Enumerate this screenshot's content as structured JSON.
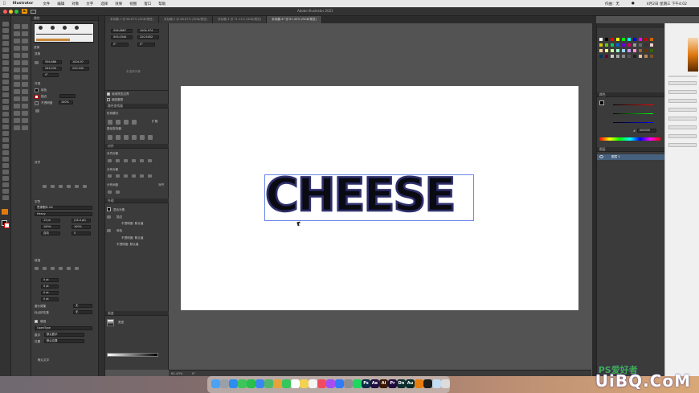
{
  "menubar": {
    "app": "Illustrator",
    "items": [
      "文件",
      "编辑",
      "对象",
      "文字",
      "选择",
      "效果",
      "视图",
      "窗口",
      "帮助"
    ],
    "right_user": "作曲：无",
    "right_clock": "4月2日 星期三 下午4:02"
  },
  "app_title": "Adobe Illustrator 2021",
  "doc_tabs": [
    "未标题-1 @ 66.67% (RGB/预览)",
    "未标题-2 @ 66.67% (RGB/预览)",
    "未标题-3 @ 71.11% (RGB/预览)",
    "未标题-4* @ 61.43% (RGB/预览)"
  ],
  "transform_top": {
    "x": "936.8867",
    "y": "543.0344",
    "w": "1004.974",
    "h": "220.5452",
    "angle": "0°",
    "shear": "0°"
  },
  "properties": {
    "title": "属性",
    "section_transform": "变换",
    "x": "936.886",
    "y": "543.034",
    "w": "1004.97",
    "h": "220.545",
    "angle": "0°",
    "section_appearance": "外观",
    "fill_label": "填色",
    "stroke_label": "描边",
    "opacity_label": "不透明度",
    "opacity_value": "100%",
    "section_align": "对齐",
    "section_character": "字符",
    "font_name": "思源黑体 CN",
    "font_style": "Heavy",
    "font_size": "13 pt",
    "leading": "(14.4 pt)",
    "tracking_a": "100%",
    "tracking_b": "100%",
    "kerning": "自动",
    "kerning_b": "0",
    "section_paragraph": "段落",
    "para_values": [
      "0 pt",
      "0 pt",
      "0 pt",
      "0 pt"
    ],
    "hyphen_label": "避头尾集",
    "hyphen_value": "无",
    "punct_label": "标点挤压集",
    "punct_value": "无",
    "section_opentype": "OpenType",
    "opentype_label": "数字",
    "opentype_value": "默认数字",
    "position_label": "位置",
    "position_value": "默认位置",
    "checkbox_label": "增强",
    "dotted_label": "默认文字"
  },
  "pathfinder": {
    "title": "路径查找器",
    "shape_modes": "形状模式",
    "expand": "扩展",
    "pathfinders": "路径查找器",
    "align_objects": "对齐对象",
    "distribute_objects": "分布对象",
    "distribute_spacing": "分布间距",
    "align_to": "对齐",
    "checkbox1": "使用预览边界",
    "checkbox2": "缩放圆角",
    "placeholder": "未选择对象"
  },
  "appearance": {
    "title": "外观",
    "group_label": "混合对象",
    "stroke_label": "描边",
    "opacity_label": "不透明度: 默认值",
    "fill_label": "填色",
    "opacity2": "不透明度: 默认值",
    "opacity3": "不透明度: 默认值"
  },
  "gradient": {
    "title": "渐变",
    "type_label": "类型"
  },
  "color_panel": {
    "title": "颜色",
    "hex_label": "#",
    "hex": "000000"
  },
  "layers": {
    "title": "图层",
    "layer_name": "图层 1"
  },
  "status": {
    "zoom": "61.43%",
    "angle": "0°"
  },
  "artboard": {
    "text": "CHEESE"
  },
  "dock_icons": [
    {
      "name": "finder",
      "label": "",
      "color": "#4aa3f2"
    },
    {
      "name": "launchpad",
      "label": "",
      "color": "#9aa0aa"
    },
    {
      "name": "safari",
      "label": "",
      "color": "#2d8cf0"
    },
    {
      "name": "messages",
      "label": "",
      "color": "#3cc55a"
    },
    {
      "name": "wechat",
      "label": "",
      "color": "#27c04a"
    },
    {
      "name": "mail",
      "label": "",
      "color": "#3a87f0"
    },
    {
      "name": "maps",
      "label": "",
      "color": "#4fb96a"
    },
    {
      "name": "photos",
      "label": "",
      "color": "#e8a23a"
    },
    {
      "name": "facetime",
      "label": "",
      "color": "#34c759"
    },
    {
      "name": "calendar",
      "label": "18",
      "color": "#ffffff"
    },
    {
      "name": "notes",
      "label": "",
      "color": "#f2d250"
    },
    {
      "name": "reminders",
      "label": "",
      "color": "#f4f4f4"
    },
    {
      "name": "music",
      "label": "",
      "color": "#f24a5e"
    },
    {
      "name": "podcasts",
      "label": "",
      "color": "#a54ff2"
    },
    {
      "name": "appstore",
      "label": "",
      "color": "#2f7cf6"
    },
    {
      "name": "settings",
      "label": "",
      "color": "#8e8e93"
    },
    {
      "name": "spotify",
      "label": "",
      "color": "#1ed760"
    },
    {
      "name": "photoshop",
      "label": "Ps",
      "color": "#0b2a4a"
    },
    {
      "name": "aftereffects",
      "label": "Ae",
      "color": "#1f0f3f"
    },
    {
      "name": "illustrator",
      "label": "Ai",
      "color": "#3a1a00"
    },
    {
      "name": "premiere",
      "label": "Pr",
      "color": "#1f0b3a"
    },
    {
      "name": "dimension",
      "label": "Dn",
      "color": "#0b2e2e"
    },
    {
      "name": "audition",
      "label": "Au",
      "color": "#0a2b2b"
    },
    {
      "name": "blender",
      "label": "",
      "color": "#e87d0d"
    },
    {
      "name": "figma",
      "label": "",
      "color": "#1e1e1e"
    },
    {
      "name": "preview",
      "label": "",
      "color": "#c4ddf2"
    },
    {
      "name": "trash",
      "label": "",
      "color": "#dcdcdc"
    }
  ],
  "watermark": {
    "text": "UiBQ.CoM",
    "sub": "PS爱好者"
  },
  "colors": {
    "ui_dark": "#323232",
    "panel": "#3b3b3b",
    "canvas": "#535353",
    "text_stroke": "#2e2f6b",
    "selection": "#6b87e8"
  }
}
